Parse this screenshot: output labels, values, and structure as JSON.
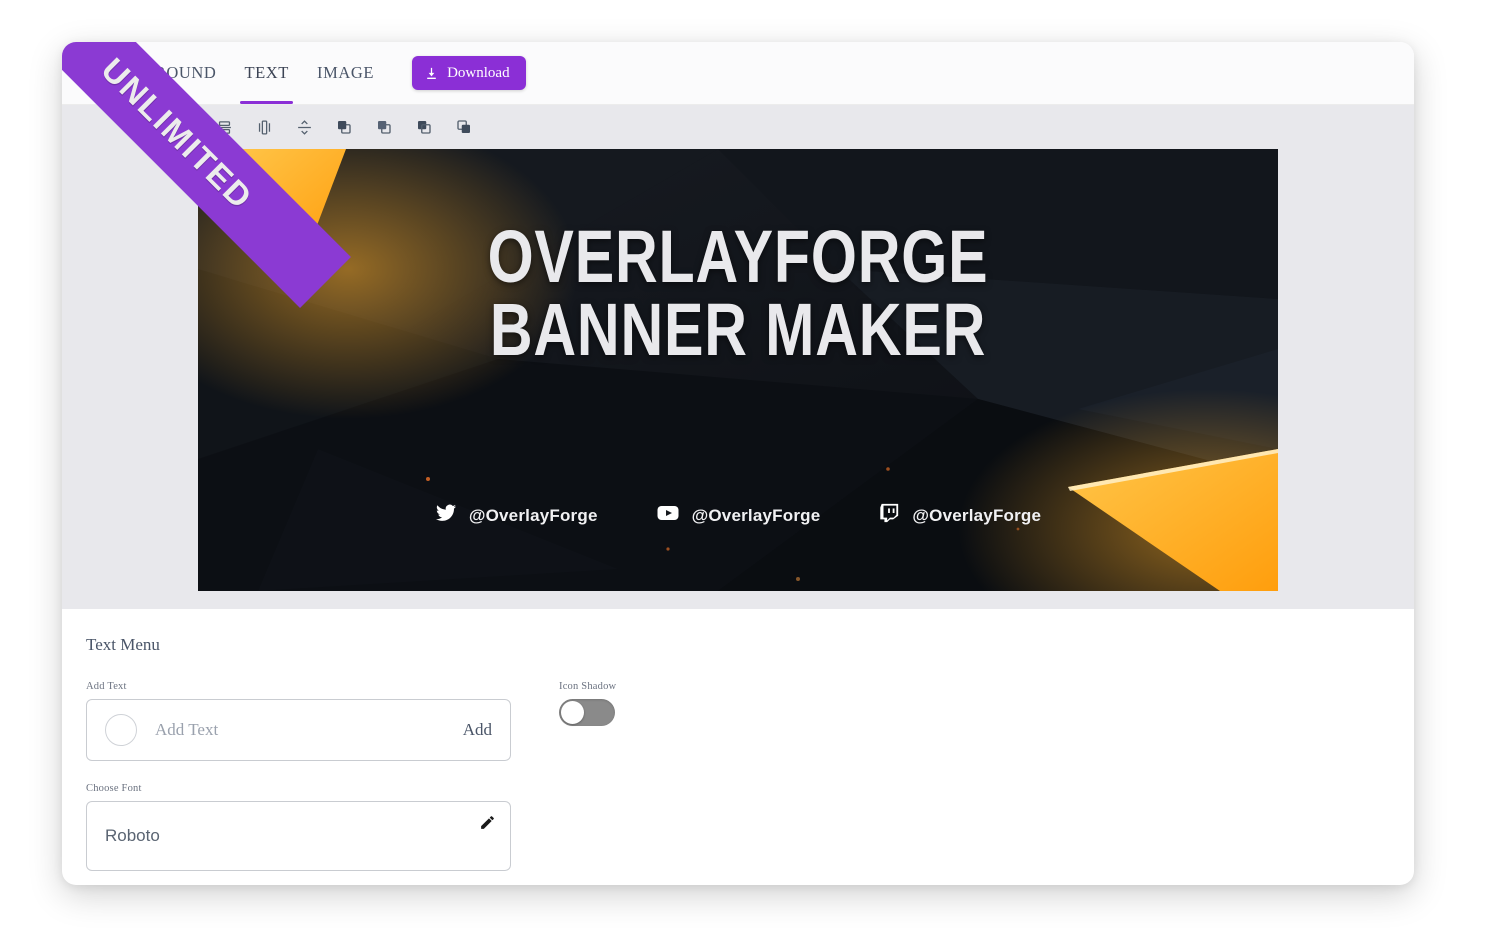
{
  "ribbon": {
    "label": "UNLIMITED"
  },
  "nav": {
    "tabs": [
      {
        "label": "BACKGROUND",
        "active": false
      },
      {
        "label": "TEXT",
        "active": true
      },
      {
        "label": "IMAGE",
        "active": false
      }
    ],
    "download_label": "Download",
    "download_icon": "download-icon",
    "accent_color": "#8b2fd6"
  },
  "toolbar": {
    "icons": [
      "align-horizontal-center-icon",
      "align-vertical-center-icon",
      "distribute-vertical-icon",
      "bring-to-front-icon",
      "send-to-back-icon",
      "bring-forward-icon",
      "send-backward-icon"
    ]
  },
  "banner": {
    "headline": "OVERLAYFORGE\nBANNER MAKER",
    "background_color": "#0e1014",
    "accent_color": "#ffa91e",
    "socials": [
      {
        "icon": "twitter-icon",
        "handle": "@OverlayForge"
      },
      {
        "icon": "youtube-icon",
        "handle": "@OverlayForge"
      },
      {
        "icon": "twitch-icon",
        "handle": "@OverlayForge"
      }
    ]
  },
  "panel": {
    "title": "Text Menu",
    "add_text": {
      "label": "Add Text",
      "placeholder": "Add Text",
      "value": "",
      "add_button": "Add",
      "swatch_color": "#ffffff"
    },
    "choose_font": {
      "label": "Choose Font",
      "value": "Roboto",
      "edit_icon": "pencil-icon"
    },
    "icon_shadow": {
      "label": "Icon Shadow",
      "enabled": false
    }
  }
}
